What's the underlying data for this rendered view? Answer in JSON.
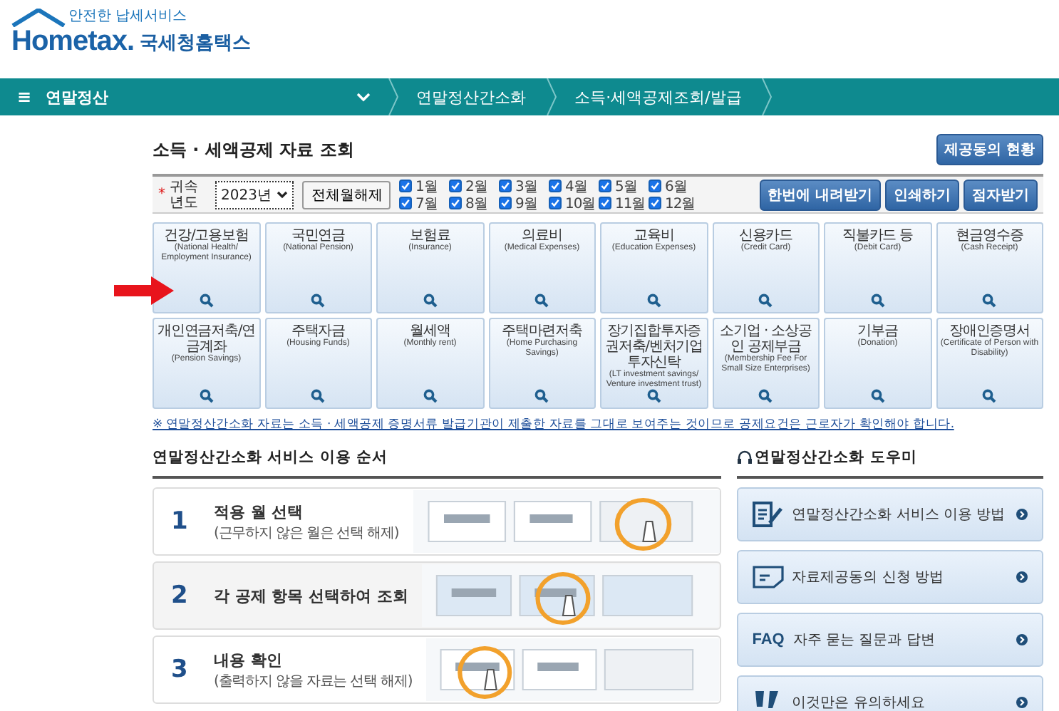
{
  "header": {
    "tagline": "안전한 납세서비스",
    "logo": "Hometax.",
    "site_name": "국세청홈택스"
  },
  "nav": {
    "menu_icon": "≡",
    "menu": "연말정산",
    "breadcrumbs": [
      "연말정산간소화",
      "소득·세액공제조회/발급"
    ]
  },
  "page": {
    "title": "소득 · 세액공제 자료 조회",
    "consent_button": "제공동의 현황"
  },
  "filter": {
    "required_mark": "*",
    "year_label": "귀속년도",
    "year": "2023년",
    "toggle_all": "전체월해제",
    "months": [
      {
        "label": "1월",
        "checked": true
      },
      {
        "label": "2월",
        "checked": true
      },
      {
        "label": "3월",
        "checked": true
      },
      {
        "label": "4월",
        "checked": true
      },
      {
        "label": "5월",
        "checked": true
      },
      {
        "label": "6월",
        "checked": true
      },
      {
        "label": "7월",
        "checked": true
      },
      {
        "label": "8월",
        "checked": true
      },
      {
        "label": "9월",
        "checked": true
      },
      {
        "label": "10월",
        "checked": true
      },
      {
        "label": "11월",
        "checked": true
      },
      {
        "label": "12월",
        "checked": true
      }
    ],
    "actions": [
      "한번에 내려받기",
      "인쇄하기",
      "점자받기"
    ]
  },
  "categories": [
    {
      "title": "건강/고용보험",
      "subtitle": "(National Health/ Employment Insurance)",
      "pointed": true
    },
    {
      "title": "국민연금",
      "subtitle": "(National Pension)",
      "pointed": false
    },
    {
      "title": "보험료",
      "subtitle": "(Insurance)",
      "pointed": false
    },
    {
      "title": "의료비",
      "subtitle": "(Medical Expenses)",
      "pointed": false
    },
    {
      "title": "교육비",
      "subtitle": "(Education Expenses)",
      "pointed": false
    },
    {
      "title": "신용카드",
      "subtitle": "(Credit Card)",
      "pointed": false
    },
    {
      "title": "직불카드 등",
      "subtitle": "(Debit Card)",
      "pointed": false
    },
    {
      "title": "현금영수증",
      "subtitle": "(Cash Receipt)",
      "pointed": false
    },
    {
      "title": "개인연금저축/연금계좌",
      "subtitle": "(Pension Savings)",
      "pointed": false
    },
    {
      "title": "주택자금",
      "subtitle": "(Housing Funds)",
      "pointed": false
    },
    {
      "title": "월세액",
      "subtitle": "(Monthly rent)",
      "pointed": false
    },
    {
      "title": "주택마련저축",
      "subtitle": "(Home Purchasing Savings)",
      "pointed": false
    },
    {
      "title": "장기집합투자증권저축/벤처기업투자신탁",
      "subtitle": "(LT investment savings/ Venture investment trust)",
      "pointed": false
    },
    {
      "title": "소기업 · 소상공인 공제부금",
      "subtitle": "(Membership Fee For Small Size Enterprises)",
      "pointed": false
    },
    {
      "title": "기부금",
      "subtitle": "(Donation)",
      "pointed": false
    },
    {
      "title": "장애인증명서",
      "subtitle": "(Certificate of Person with Disability)",
      "pointed": false
    }
  ],
  "notice": "※ 연말정산간소화 자료는 소득 · 세액공제 증명서류 발급기관이 제출한 자료를 그대로 보여주는 것이므로 공제요건은 근로자가 확인해야 합니다.",
  "guide": {
    "title": "연말정산간소화 서비스 이용 순서",
    "steps": [
      {
        "number": "1",
        "title": "적용 월 선택",
        "subtitle": "(근무하지 않은 월은 선택 해제)"
      },
      {
        "number": "2",
        "title": "각 공제 항목 선택하여 조회"
      },
      {
        "number": "3",
        "title": "내용 확인",
        "subtitle": "(출력하지 않을 자료는 선택 해제)"
      }
    ]
  },
  "help": {
    "title": "연말정산간소화 도우미",
    "items": [
      {
        "kind": "document",
        "label": "연말정산간소화 서비스 이용 방법"
      },
      {
        "kind": "form",
        "label": "자료제공동의 신청 방법"
      },
      {
        "kind": "faq",
        "badge": "FAQ",
        "label": "자주 묻는 질문과 답변"
      },
      {
        "kind": "warning",
        "label": "이것만은 유의하세요"
      }
    ]
  }
}
